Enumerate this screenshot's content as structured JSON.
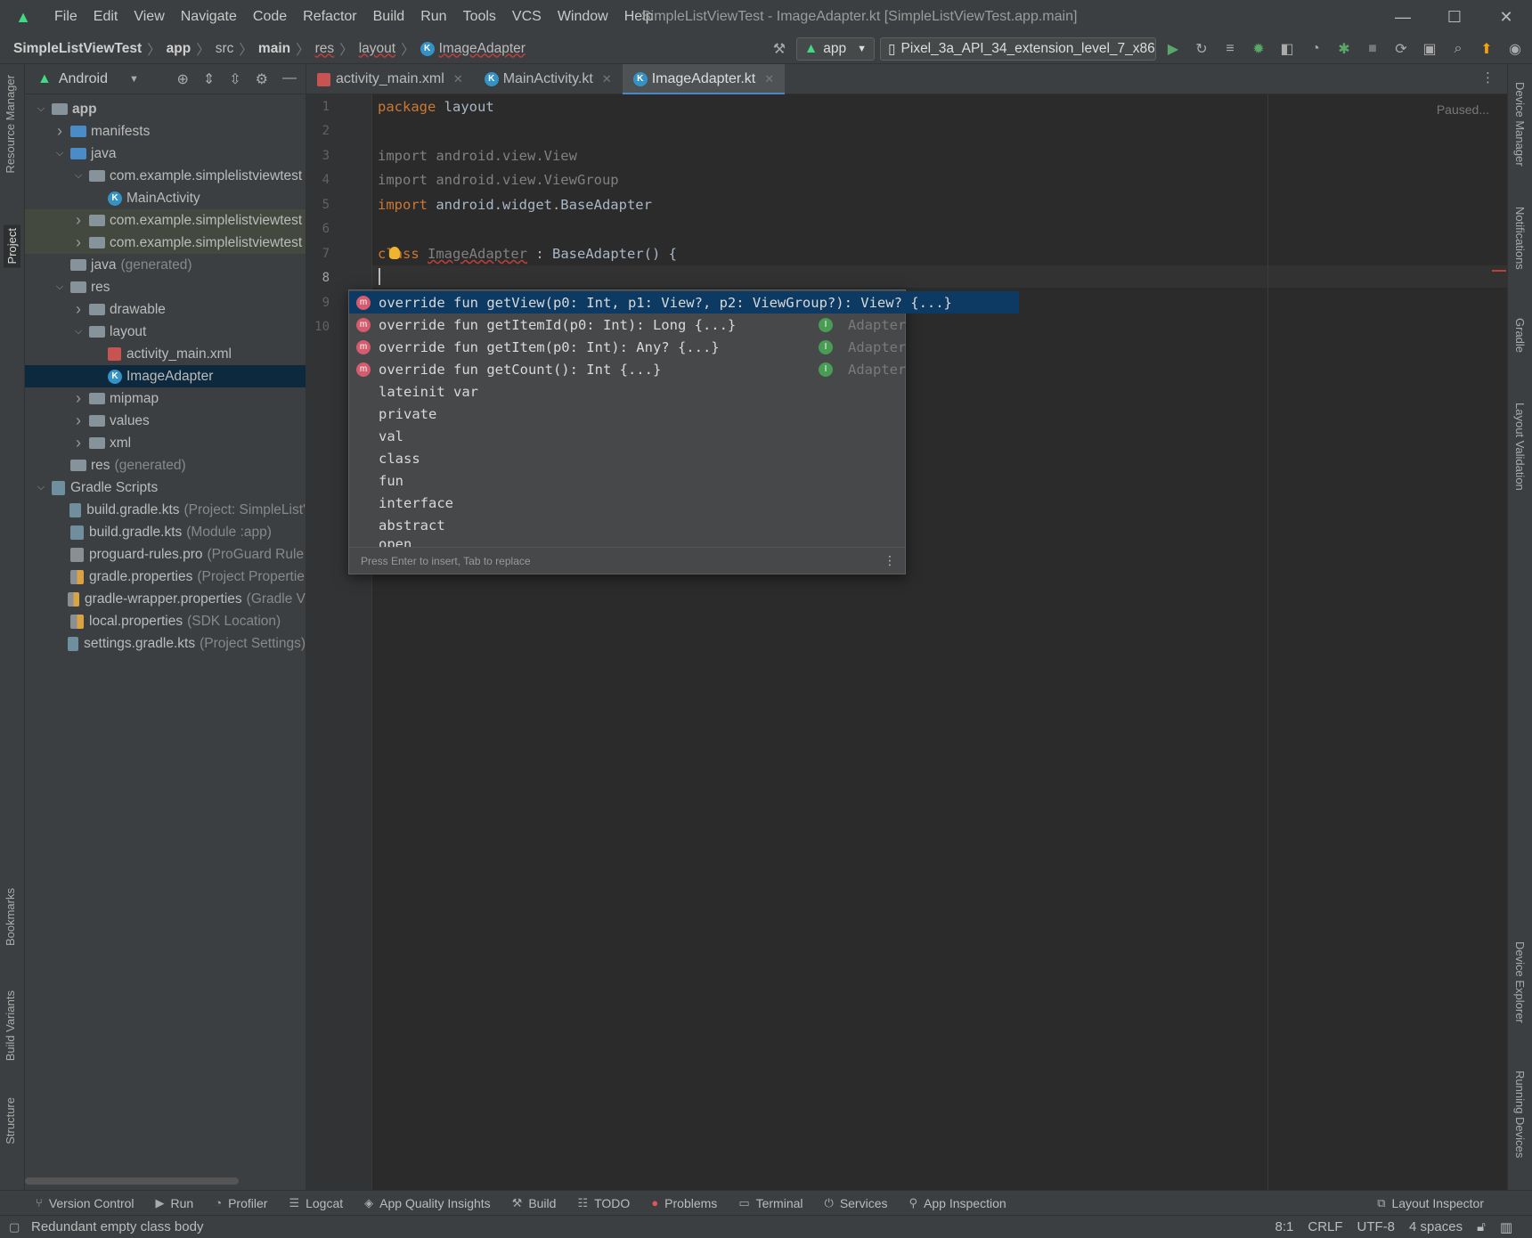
{
  "menu": [
    "File",
    "Edit",
    "View",
    "Navigate",
    "Code",
    "Refactor",
    "Build",
    "Run",
    "Tools",
    "VCS",
    "Window",
    "Help"
  ],
  "window_title": "SimpleListViewTest - ImageAdapter.kt [SimpleListViewTest.app.main]",
  "breadcrumb": {
    "project": "SimpleListViewTest",
    "module": "app",
    "src": "src",
    "main": "main",
    "res": "res",
    "layout": "layout",
    "file": "ImageAdapter"
  },
  "toolbar": {
    "run_config": "app",
    "device": "Pixel_3a_API_34_extension_level_7_x86..."
  },
  "project_panel": {
    "view": "Android",
    "tree": [
      {
        "label": "app",
        "note": "",
        "depth": 0,
        "arrow": "open",
        "icon": "module"
      },
      {
        "label": "manifests",
        "note": "",
        "depth": 1,
        "arrow": "closed",
        "icon": "folder-blue"
      },
      {
        "label": "java",
        "note": "",
        "depth": 1,
        "arrow": "open",
        "icon": "folder-blue"
      },
      {
        "label": "com.example.simplelistviewtest",
        "note": "",
        "depth": 2,
        "arrow": "open",
        "icon": "package"
      },
      {
        "label": "MainActivity",
        "note": "",
        "depth": 3,
        "arrow": "none",
        "icon": "kotlin"
      },
      {
        "label": "com.example.simplelistviewtest",
        "note": "",
        "depth": 2,
        "arrow": "closed",
        "icon": "package",
        "highlight": true
      },
      {
        "label": "com.example.simplelistviewtest",
        "note": "",
        "depth": 2,
        "arrow": "closed",
        "icon": "package",
        "highlight": true
      },
      {
        "label": "java",
        "note": "(generated)",
        "depth": 1,
        "arrow": "none",
        "icon": "folder"
      },
      {
        "label": "res",
        "note": "",
        "depth": 1,
        "arrow": "open",
        "icon": "folder"
      },
      {
        "label": "drawable",
        "note": "",
        "depth": 2,
        "arrow": "closed",
        "icon": "folder"
      },
      {
        "label": "layout",
        "note": "",
        "depth": 2,
        "arrow": "open",
        "icon": "folder"
      },
      {
        "label": "activity_main.xml",
        "note": "",
        "depth": 3,
        "arrow": "none",
        "icon": "xml"
      },
      {
        "label": "ImageAdapter",
        "note": "",
        "depth": 3,
        "arrow": "none",
        "icon": "kotlin",
        "selected": true
      },
      {
        "label": "mipmap",
        "note": "",
        "depth": 2,
        "arrow": "closed",
        "icon": "folder"
      },
      {
        "label": "values",
        "note": "",
        "depth": 2,
        "arrow": "closed",
        "icon": "folder"
      },
      {
        "label": "xml",
        "note": "",
        "depth": 2,
        "arrow": "closed",
        "icon": "folder"
      },
      {
        "label": "res",
        "note": "(generated)",
        "depth": 1,
        "arrow": "none",
        "icon": "folder"
      },
      {
        "label": "Gradle Scripts",
        "note": "",
        "depth": 0,
        "arrow": "open",
        "icon": "gradle"
      },
      {
        "label": "build.gradle.kts",
        "note": "(Project: SimpleList'",
        "depth": 1,
        "arrow": "none",
        "icon": "gradle"
      },
      {
        "label": "build.gradle.kts",
        "note": "(Module :app)",
        "depth": 1,
        "arrow": "none",
        "icon": "gradle"
      },
      {
        "label": "proguard-rules.pro",
        "note": "(ProGuard Rule",
        "depth": 1,
        "arrow": "none",
        "icon": "file"
      },
      {
        "label": "gradle.properties",
        "note": "(Project Propertie",
        "depth": 1,
        "arrow": "none",
        "icon": "props"
      },
      {
        "label": "gradle-wrapper.properties",
        "note": "(Gradle V",
        "depth": 1,
        "arrow": "none",
        "icon": "props"
      },
      {
        "label": "local.properties",
        "note": "(SDK Location)",
        "depth": 1,
        "arrow": "none",
        "icon": "props"
      },
      {
        "label": "settings.gradle.kts",
        "note": "(Project Settings)",
        "depth": 1,
        "arrow": "none",
        "icon": "gradle"
      }
    ]
  },
  "left_tool_windows": {
    "resource_manager": "Resource Manager",
    "project": "Project",
    "bookmarks": "Bookmarks",
    "build_variants": "Build Variants",
    "structure": "Structure"
  },
  "right_tool_windows": {
    "device_manager": "Device Manager",
    "notifications": "Notifications",
    "gradle": "Gradle",
    "layout_validation": "Layout Validation",
    "device_explorer": "Device Explorer",
    "running_devices": "Running Devices"
  },
  "editor_tabs": [
    {
      "label": "activity_main.xml",
      "icon": "xml",
      "active": false
    },
    {
      "label": "MainActivity.kt",
      "icon": "kotlin",
      "active": false
    },
    {
      "label": "ImageAdapter.kt",
      "icon": "kotlin",
      "active": true
    }
  ],
  "editor": {
    "paused": "Paused...",
    "line_numbers": [
      "1",
      "2",
      "3",
      "4",
      "5",
      "6",
      "7",
      "8",
      "9",
      "10"
    ],
    "current_line": "8",
    "lines": {
      "l1_kw": "package",
      "l1_rest": " layout",
      "l3_kw": "import",
      "l3_rest": " android.view.View",
      "l4_kw": "import",
      "l4_rest": " android.view.ViewGroup",
      "l5_kw": "import",
      "l5_rest": " android.widget.BaseAdapter",
      "l7_kw": "class",
      "l7_name": "ImageAdapter",
      "l7_rest": " : BaseAdapter() {"
    }
  },
  "completion": {
    "items": [
      {
        "text": "override fun getView(p0: Int, p1: View?, p2: ViewGroup?): View? {...}",
        "icon": "m",
        "type": ""
      },
      {
        "text": "override fun getItemId(p0: Int): Long {...}",
        "icon": "m",
        "type": "Adapter"
      },
      {
        "text": "override fun getItem(p0: Int): Any? {...}",
        "icon": "m",
        "type": "Adapter"
      },
      {
        "text": "override fun getCount(): Int {...}",
        "icon": "m",
        "type": "Adapter"
      },
      {
        "text": "lateinit var",
        "icon": "",
        "type": ""
      },
      {
        "text": "private",
        "icon": "",
        "type": ""
      },
      {
        "text": "val",
        "icon": "",
        "type": ""
      },
      {
        "text": "class",
        "icon": "",
        "type": ""
      },
      {
        "text": "fun",
        "icon": "",
        "type": ""
      },
      {
        "text": "interface",
        "icon": "",
        "type": ""
      },
      {
        "text": "abstract",
        "icon": "",
        "type": ""
      },
      {
        "text": "open",
        "icon": "",
        "type": ""
      }
    ],
    "footer": "Press Enter to insert, Tab to replace"
  },
  "bottom_tools": [
    "Version Control",
    "Run",
    "Profiler",
    "Logcat",
    "App Quality Insights",
    "Build",
    "TODO",
    "Problems",
    "Terminal",
    "Services",
    "App Inspection"
  ],
  "layout_inspector": "Layout Inspector",
  "status": {
    "message": "Redundant empty class body",
    "position": "8:1",
    "line_sep": "CRLF",
    "encoding": "UTF-8",
    "indent": "4 spaces"
  },
  "colors": {
    "accent": "#4a88c7",
    "selection": "#0d293e",
    "keyword": "#cc7832",
    "kotlin_icon": "#3592c4",
    "android_green": "#3ddc84",
    "error": "#bc3f3c"
  }
}
